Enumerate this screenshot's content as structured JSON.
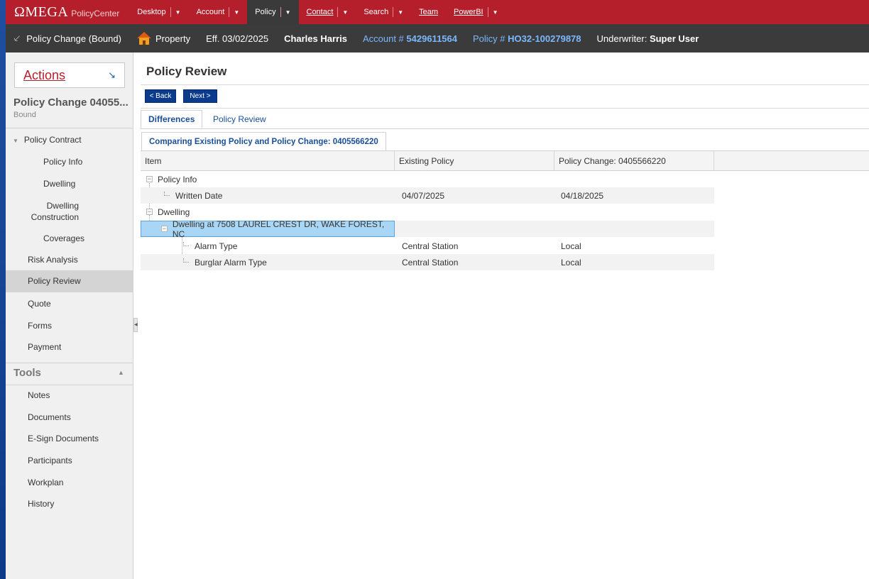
{
  "app": {
    "logo": "ΩMEGA",
    "product": "PolicyCenter"
  },
  "topnav": [
    {
      "label": "Desktop",
      "has_caret": true
    },
    {
      "label": "Account",
      "has_caret": true
    },
    {
      "label": "Policy",
      "has_caret": true,
      "active": true
    },
    {
      "label": "Contact",
      "has_caret": true
    },
    {
      "label": "Search",
      "has_caret": true
    },
    {
      "label": "Team",
      "has_caret": false
    },
    {
      "label": "PowerBI",
      "has_caret": true
    }
  ],
  "infobar": {
    "transaction": "Policy Change (Bound)",
    "line": "Property",
    "effective": "Eff. 03/02/2025",
    "insured": "Charles Harris",
    "account_label": "Account #",
    "account_number": "5429611564",
    "policy_label": "Policy #",
    "policy_number": "HO32-100279878",
    "underwriter_label": "Underwriter:",
    "underwriter": "Super User"
  },
  "sidebar": {
    "actions_label": "Actions",
    "title": "Policy Change 04055...",
    "status": "Bound",
    "section_label": "Policy Contract",
    "items": [
      {
        "label": "Policy Info"
      },
      {
        "label": "Dwelling"
      },
      {
        "label": "Dwelling Construction"
      },
      {
        "label": "Coverages"
      },
      {
        "label": "Risk Analysis"
      },
      {
        "label": "Policy Review",
        "selected": true
      },
      {
        "label": "Quote"
      },
      {
        "label": "Forms"
      },
      {
        "label": "Payment"
      }
    ],
    "tools_label": "Tools",
    "tools": [
      {
        "label": "Notes"
      },
      {
        "label": "Documents"
      },
      {
        "label": "E-Sign Documents"
      },
      {
        "label": "Participants"
      },
      {
        "label": "Workplan"
      },
      {
        "label": "History"
      }
    ]
  },
  "main": {
    "title": "Policy Review",
    "back_label": "< Back",
    "next_label": "Next >",
    "tabs": [
      {
        "label": "Differences",
        "active": true
      },
      {
        "label": "Policy Review",
        "active": false
      }
    ],
    "subtab": "Comparing Existing Policy and Policy Change: 0405566220",
    "columns": [
      "Item",
      "Existing Policy",
      "Policy Change: 0405566220"
    ],
    "rows": [
      {
        "item": "Policy Info",
        "existing": "",
        "change": ""
      },
      {
        "item": "Written Date",
        "existing": "04/07/2025",
        "change": "04/18/2025"
      },
      {
        "item": "Dwelling",
        "existing": "",
        "change": ""
      },
      {
        "item": "Dwelling at 7508 LAUREL CREST DR, WAKE FOREST, NC",
        "existing": "",
        "change": ""
      },
      {
        "item": "Alarm Type",
        "existing": "Central Station",
        "change": "Local"
      },
      {
        "item": "Burglar Alarm Type",
        "existing": "Central Station",
        "change": "Local"
      }
    ]
  },
  "colors": {
    "brand_red": "#b41f2b",
    "dark_bar": "#3b3b3b",
    "button_blue": "#0b3b8c",
    "link_blue": "#1a4f98",
    "highlight": "#a9d6f5"
  }
}
